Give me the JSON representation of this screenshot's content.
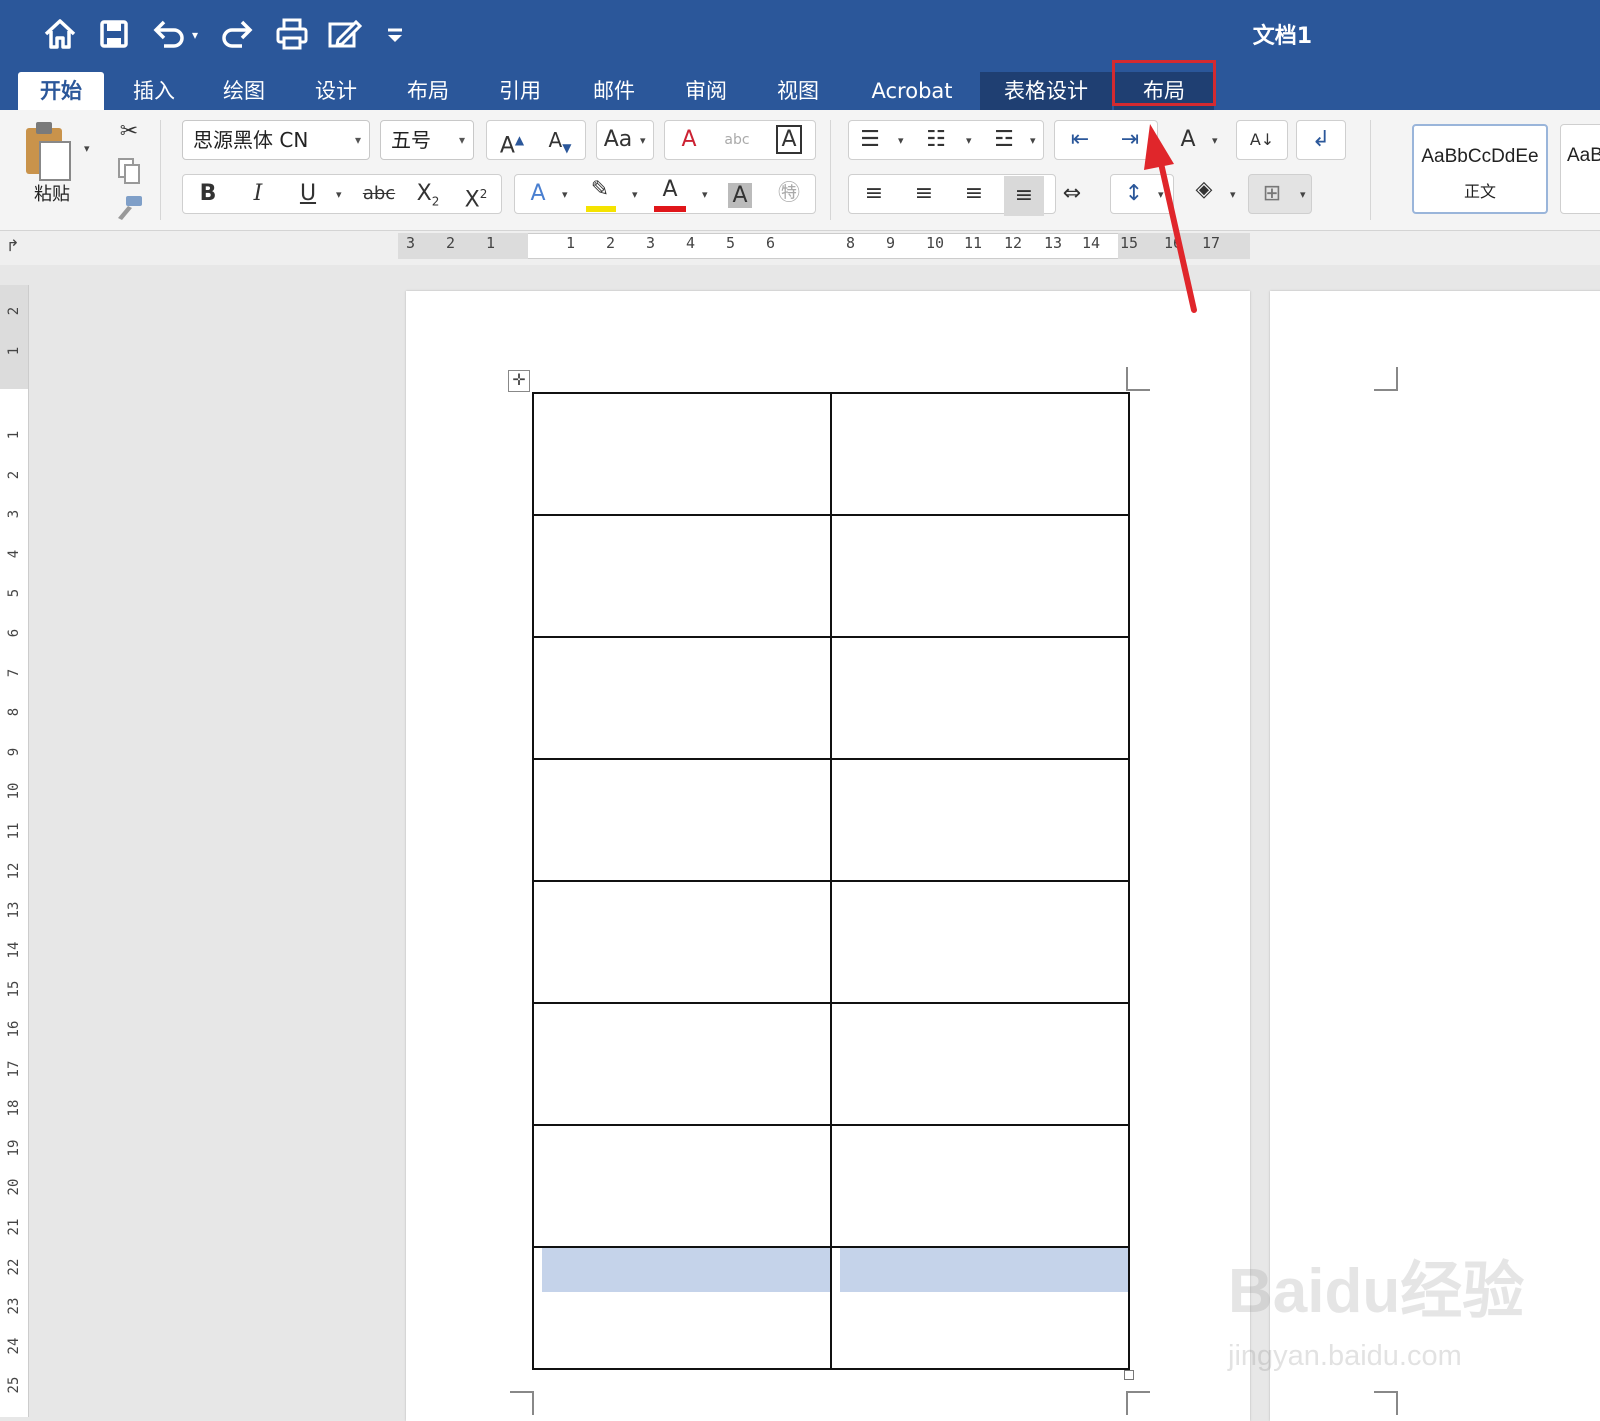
{
  "window": {
    "title": "文档1"
  },
  "quick_access": {
    "icons": [
      "home-icon",
      "save-icon",
      "undo-icon",
      "redo-icon",
      "print-icon",
      "edit-document-icon",
      "customize-toolbar-icon"
    ]
  },
  "tabs": [
    {
      "label": "开始",
      "active": true
    },
    {
      "label": "插入"
    },
    {
      "label": "绘图"
    },
    {
      "label": "设计"
    },
    {
      "label": "布局"
    },
    {
      "label": "引用"
    },
    {
      "label": "邮件"
    },
    {
      "label": "审阅"
    },
    {
      "label": "视图"
    },
    {
      "label": "Acrobat"
    },
    {
      "label": "表格设计",
      "contextual": true
    },
    {
      "label": "布局",
      "contextual": true,
      "highlighted": true
    }
  ],
  "ribbon": {
    "paste_label": "粘贴",
    "font_name": "思源黑体 CN",
    "font_size": "五号",
    "strikethrough_label": "abc",
    "styles": [
      {
        "sample": "AaBbCcDdEe",
        "name": "正文"
      },
      {
        "sample": "AaB"
      }
    ],
    "highlight_color": "#f5e300",
    "font_color": "#e0161a"
  },
  "ruler": {
    "horizontal_ticks": [
      "3",
      "2",
      "1",
      "1",
      "2",
      "3",
      "4",
      "5",
      "6",
      "8",
      "9",
      "10",
      "11",
      "12",
      "13",
      "14",
      "15",
      "16",
      "17"
    ],
    "vertical_ticks": [
      "2",
      "1",
      "1",
      "2",
      "3",
      "4",
      "5",
      "6",
      "7",
      "8",
      "9",
      "10",
      "11",
      "12",
      "13",
      "14",
      "15",
      "16",
      "17",
      "18",
      "19",
      "20",
      "21",
      "22",
      "23",
      "24",
      "25"
    ]
  },
  "document": {
    "table": {
      "rows": 8,
      "columns": 2,
      "selected_row": 8
    }
  },
  "watermark": {
    "brand": "Baidu经验",
    "url": "jingyan.baidu.com"
  },
  "colors": {
    "title_bar": "#2b579a",
    "annotation_red": "#d42a30",
    "selection": "#c5d3ea"
  }
}
